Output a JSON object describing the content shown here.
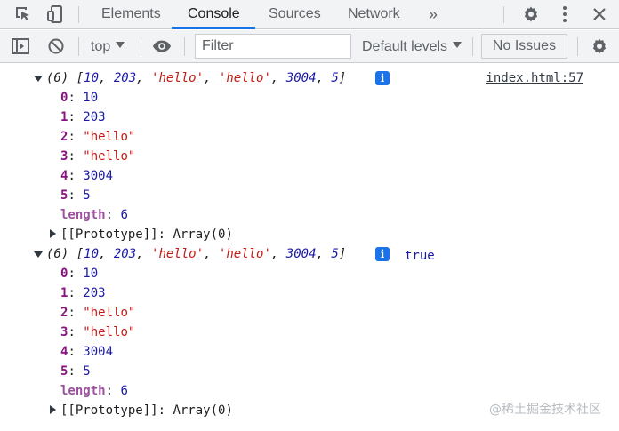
{
  "tabs": {
    "items": [
      "Elements",
      "Console",
      "Sources",
      "Network"
    ],
    "more": "»",
    "active": "Console"
  },
  "toolbar": {
    "context": "top",
    "filter_placeholder": "Filter",
    "levels": "Default levels",
    "issues": "No Issues"
  },
  "logs": [
    {
      "summary_prefix": "(6) [",
      "summary_items": [
        "10",
        "203",
        "'hello'",
        "'hello'",
        "3004",
        "5"
      ],
      "summary_suffix": "]",
      "source": "index.html:57",
      "trailing_value": "",
      "entries": [
        {
          "key": "0",
          "value": "10",
          "type": "num"
        },
        {
          "key": "1",
          "value": "203",
          "type": "num"
        },
        {
          "key": "2",
          "value": "\"hello\"",
          "type": "str"
        },
        {
          "key": "3",
          "value": "\"hello\"",
          "type": "str"
        },
        {
          "key": "4",
          "value": "3004",
          "type": "num"
        },
        {
          "key": "5",
          "value": "5",
          "type": "num"
        }
      ],
      "length_key": "length",
      "length_value": "6",
      "prototype_key": "[[Prototype]]",
      "prototype_value": "Array(0)"
    },
    {
      "summary_prefix": "(6) [",
      "summary_items": [
        "10",
        "203",
        "'hello'",
        "'hello'",
        "3004",
        "5"
      ],
      "summary_suffix": "]",
      "source": "",
      "trailing_value": "true",
      "entries": [
        {
          "key": "0",
          "value": "10",
          "type": "num"
        },
        {
          "key": "1",
          "value": "203",
          "type": "num"
        },
        {
          "key": "2",
          "value": "\"hello\"",
          "type": "str"
        },
        {
          "key": "3",
          "value": "\"hello\"",
          "type": "str"
        },
        {
          "key": "4",
          "value": "3004",
          "type": "num"
        },
        {
          "key": "5",
          "value": "5",
          "type": "num"
        }
      ],
      "length_key": "length",
      "length_value": "6",
      "prototype_key": "[[Prototype]]",
      "prototype_value": "Array(0)"
    }
  ],
  "watermark": "@稀土掘金技术社区"
}
